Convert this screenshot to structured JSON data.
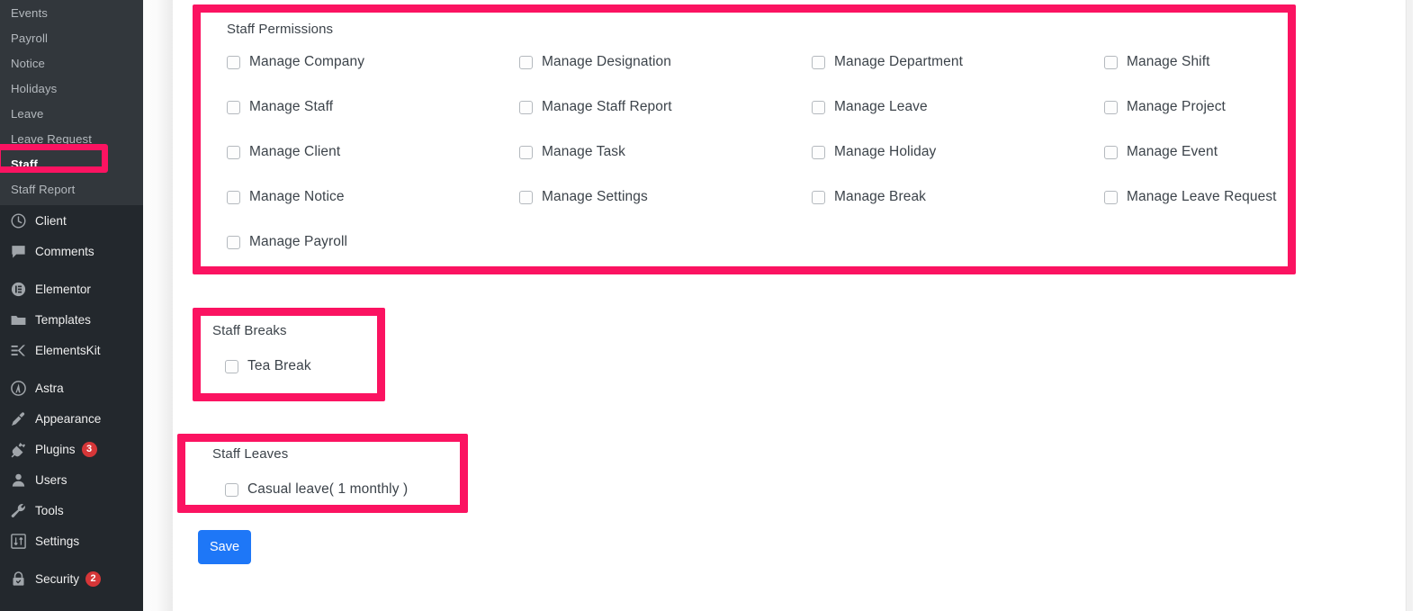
{
  "colors": {
    "annotation": "#fb1361",
    "sidebar_bg": "#23282d",
    "sidebar_submenu_bg": "#32373c",
    "save_button": "#1e77f7",
    "badge": "#d63638"
  },
  "sidebar": {
    "submenu_items": [
      {
        "label": "Events",
        "current": false
      },
      {
        "label": "Payroll",
        "current": false
      },
      {
        "label": "Notice",
        "current": false
      },
      {
        "label": "Holidays",
        "current": false
      },
      {
        "label": "Leave",
        "current": false
      },
      {
        "label": "Leave Request",
        "current": false
      },
      {
        "label": "Staff",
        "current": true
      },
      {
        "label": "Staff Report",
        "current": false
      }
    ],
    "top_items": [
      {
        "label": "Client",
        "icon": "clock-icon",
        "badge": ""
      },
      {
        "label": "Comments",
        "icon": "comment-icon",
        "badge": ""
      },
      {
        "label": "Elementor",
        "icon": "elementor-icon",
        "badge": ""
      },
      {
        "label": "Templates",
        "icon": "folder-icon",
        "badge": ""
      },
      {
        "label": "ElementsKit",
        "icon": "elementskit-icon",
        "badge": ""
      },
      {
        "label": "Astra",
        "icon": "astra-icon",
        "badge": ""
      },
      {
        "label": "Appearance",
        "icon": "brush-icon",
        "badge": ""
      },
      {
        "label": "Plugins",
        "icon": "plug-icon",
        "badge": "3"
      },
      {
        "label": "Users",
        "icon": "user-icon",
        "badge": ""
      },
      {
        "label": "Tools",
        "icon": "wrench-icon",
        "badge": ""
      },
      {
        "label": "Settings",
        "icon": "sliders-icon",
        "badge": ""
      },
      {
        "label": "Security",
        "icon": "lock-icon",
        "badge": "2"
      }
    ]
  },
  "main": {
    "staff_permissions": {
      "title": "Staff Permissions",
      "rows": [
        [
          "Manage Company",
          "Manage Designation",
          "Manage Department",
          "Manage Shift"
        ],
        [
          "Manage Staff",
          "Manage Staff Report",
          "Manage Leave",
          "Manage Project"
        ],
        [
          "Manage Client",
          "Manage Task",
          "Manage Holiday",
          "Manage Event"
        ],
        [
          "Manage Notice",
          "Manage Settings",
          "Manage Break",
          "Manage Leave Request"
        ],
        [
          "Manage Payroll"
        ]
      ]
    },
    "staff_breaks": {
      "title": "Staff Breaks",
      "items": [
        "Tea Break"
      ]
    },
    "staff_leaves": {
      "title": "Staff Leaves",
      "items": [
        "Casual leave( 1 monthly )"
      ]
    },
    "save_label": "Save"
  }
}
